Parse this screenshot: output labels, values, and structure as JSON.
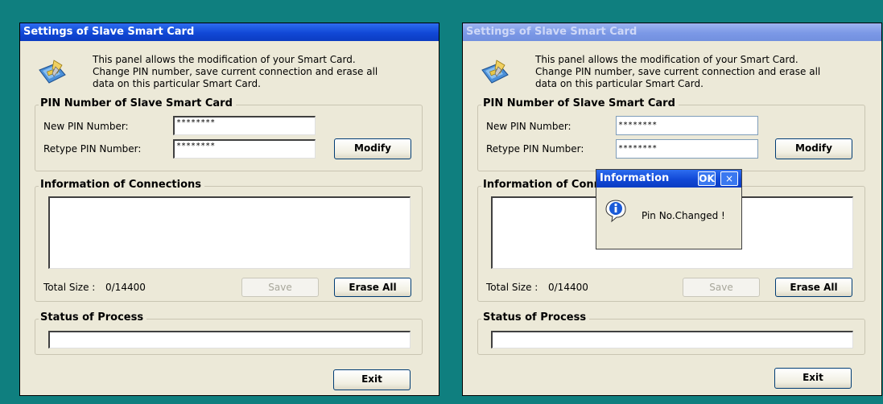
{
  "left_window": {
    "title": "Settings of Slave Smart Card",
    "intro": [
      "This panel allows the modification of your Smart Card.",
      "Change PIN number, save current connection and erase all",
      "data on this particular Smart Card."
    ],
    "pin_group_label": "PIN Number of Slave Smart Card",
    "new_pin_label": "New PIN Number:",
    "new_pin_value": "********",
    "retype_pin_label": "Retype PIN Number:",
    "retype_pin_value": "********",
    "modify_label": "Modify",
    "info_group_label": "Information of Connections",
    "total_size_label": "Total Size :",
    "total_size_value": "0/14400",
    "save_label": "Save",
    "erase_label": "Erase All",
    "status_group_label": "Status of Process",
    "exit_label": "Exit"
  },
  "right_window": {
    "title": "Settings of Slave Smart Card",
    "intro": [
      "This panel allows the modification of your Smart Card.",
      "Change PIN number, save current connection and erase all",
      "data on this particular Smart Card."
    ],
    "pin_group_label": "PIN Number of Slave Smart Card",
    "new_pin_label": "New PIN Number:",
    "new_pin_value": "********",
    "retype_pin_label": "Retype PIN Number:",
    "retype_pin_value": "********",
    "modify_label": "Modify",
    "info_group_label": "Information of Conn",
    "total_size_label": "Total Size :",
    "total_size_value": "0/14400",
    "save_label": "Save",
    "erase_label": "Erase All",
    "status_group_label": "Status of Process",
    "exit_label": "Exit"
  },
  "dialog": {
    "title": "Information",
    "ok_label": "OK",
    "close_label": "×",
    "message": "Pin No.Changed !"
  },
  "colors": {
    "desktop": "#0f7f7f",
    "titlebar_active": "#1148d6",
    "window_bg": "#ece9d8"
  }
}
